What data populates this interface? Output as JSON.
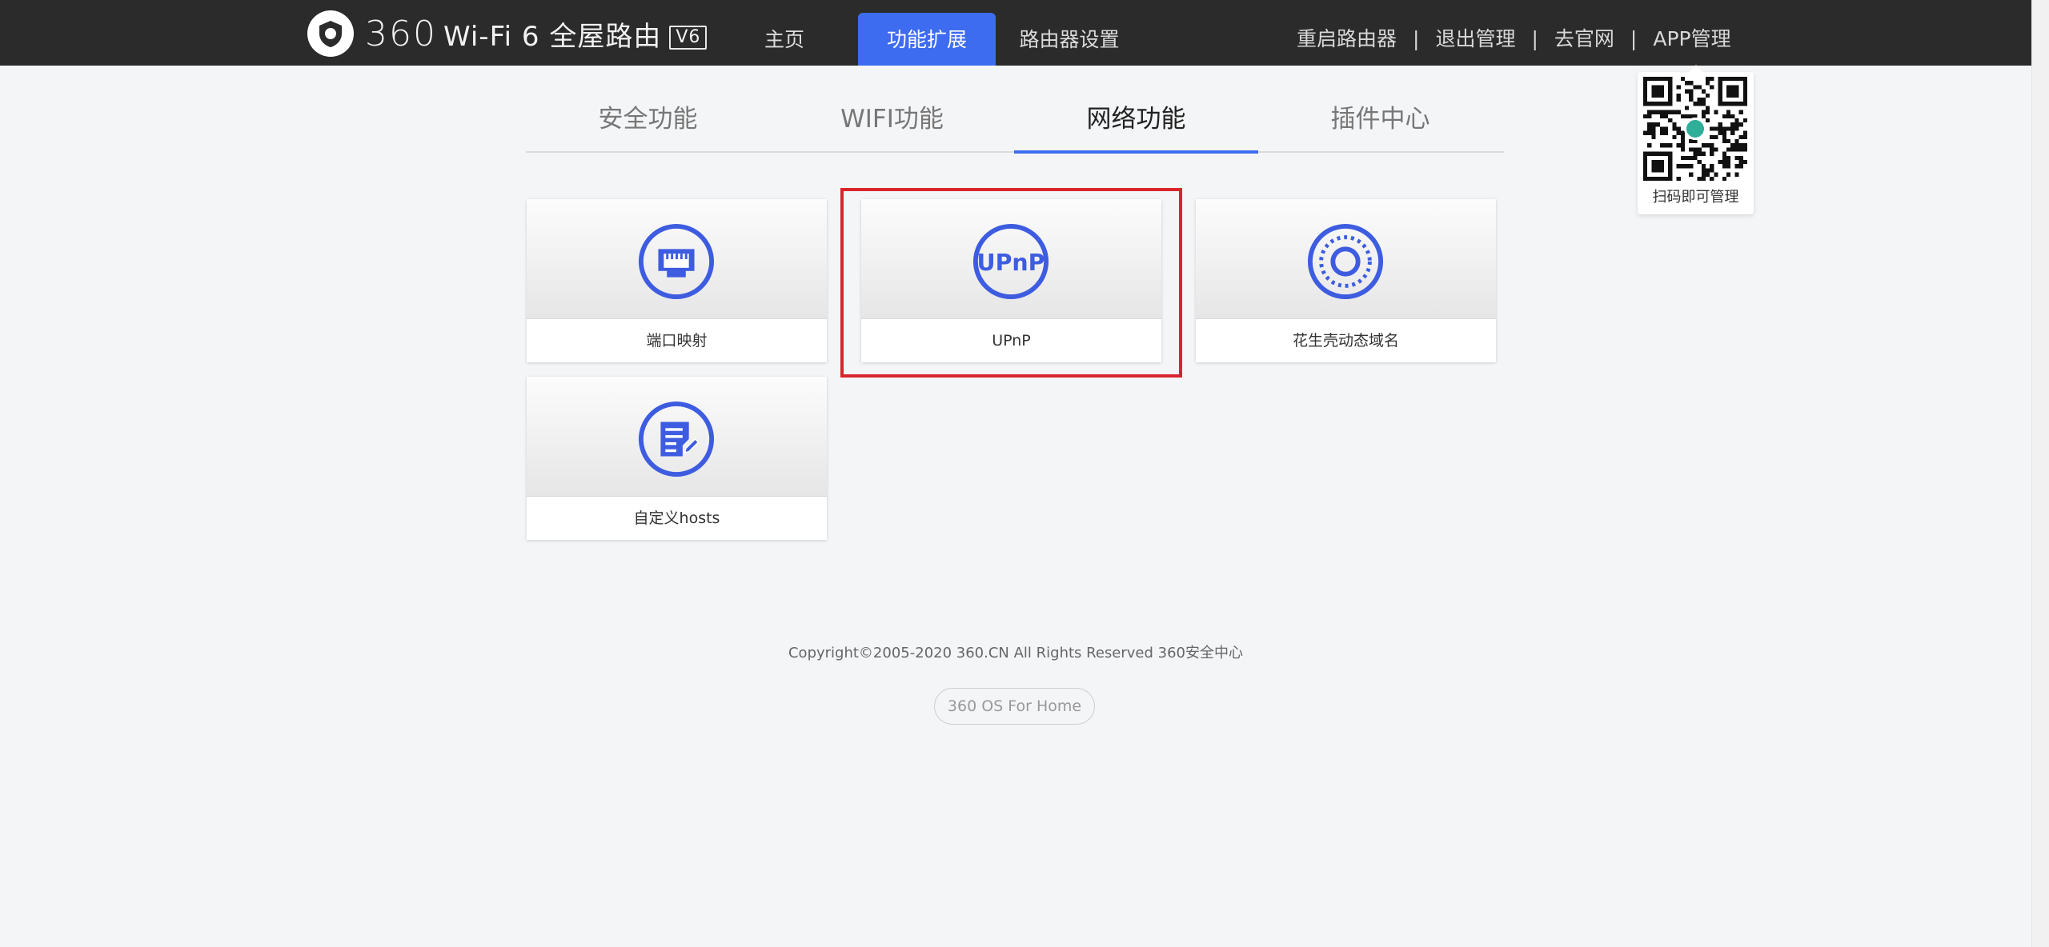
{
  "header": {
    "brand_number": "360",
    "brand_text": "Wi-Fi 6 全屋路由",
    "brand_badge": "V6",
    "nav": [
      {
        "label": "主页",
        "active": false
      },
      {
        "label": "功能扩展",
        "active": true
      },
      {
        "label": "路由器设置",
        "active": false
      }
    ],
    "links": [
      "重启路由器",
      "退出管理",
      "去官网",
      "APP管理"
    ],
    "separator": "|"
  },
  "qr_popup": {
    "caption": "扫码即可管理",
    "icon": "qr-code-icon"
  },
  "tabs": [
    {
      "label": "安全功能",
      "active": false
    },
    {
      "label": "WIFI功能",
      "active": false
    },
    {
      "label": "网络功能",
      "active": true
    },
    {
      "label": "插件中心",
      "active": false
    }
  ],
  "cards": [
    {
      "label": "端口映射",
      "icon": "ethernet-port-icon"
    },
    {
      "label": "UPnP",
      "icon": "upnp-icon"
    },
    {
      "label": "花生壳动态域名",
      "icon": "peanut-shell-ddns-icon"
    },
    {
      "label": "自定义hosts",
      "icon": "edit-document-icon"
    }
  ],
  "highlighted_card": "UPnP",
  "colors": {
    "accent": "#3d6cf0",
    "topbar": "#2b2b2b",
    "highlight_border": "#d9242c",
    "icon_blue": "#3d5ce0"
  },
  "footer": {
    "copyright": "Copyright©2005-2020 360.CN All Rights Reserved 360安全中心",
    "os_label": "360 OS For Home"
  }
}
